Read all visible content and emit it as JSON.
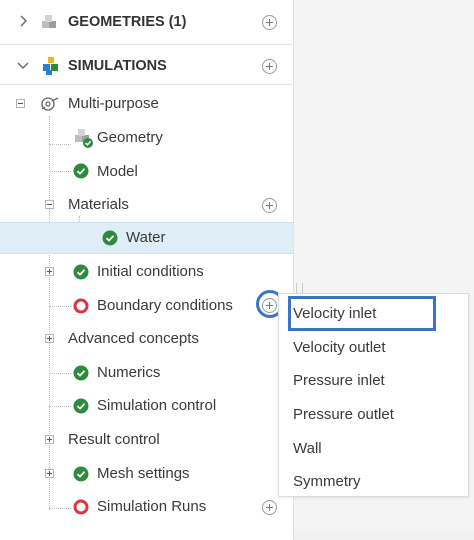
{
  "sections": {
    "geometries": {
      "label": "GEOMETRIES (1)"
    },
    "simulations": {
      "label": "SIMULATIONS"
    }
  },
  "tree": {
    "multipurpose": "Multi-purpose",
    "geometry": "Geometry",
    "model": "Model",
    "materials": "Materials",
    "water": "Water",
    "initial_conditions": "Initial conditions",
    "boundary_conditions": "Boundary conditions",
    "advanced_concepts": "Advanced concepts",
    "numerics": "Numerics",
    "simulation_control": "Simulation control",
    "result_control": "Result control",
    "mesh_settings": "Mesh settings",
    "simulation_runs": "Simulation Runs"
  },
  "dropdown": {
    "items": [
      "Velocity inlet",
      "Velocity outlet",
      "Pressure inlet",
      "Pressure outlet",
      "Wall",
      "Symmetry"
    ]
  },
  "colors": {
    "ok_green": "#2e8b3e",
    "error_red": "#d9363e",
    "highlight_blue": "#3a73c9",
    "selected_row": "#deedf6"
  },
  "icons": {
    "section_collapsed": "chevron-right-icon",
    "section_expanded": "chevron-down-icon",
    "status_ok": "check-circle-icon",
    "status_error": "error-ring-icon",
    "add": "plus-circle-icon"
  }
}
